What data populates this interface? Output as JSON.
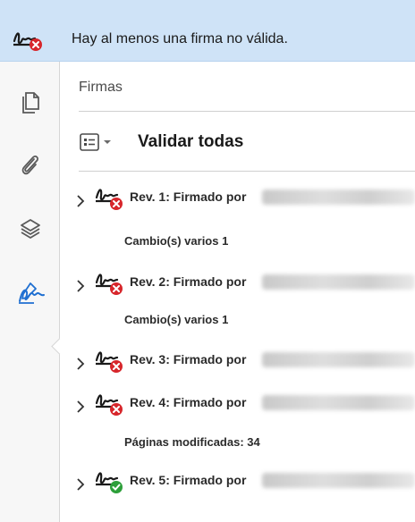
{
  "banner": {
    "message": "Hay al menos una firma no válida."
  },
  "panel": {
    "title": "Firmas",
    "validate_all": "Validar todas"
  },
  "revisions": [
    {
      "label": "Rev. 1: Firmado por",
      "status": "invalid",
      "detail": "Cambio(s) varios 1"
    },
    {
      "label": "Rev. 2: Firmado por",
      "status": "invalid",
      "detail": "Cambio(s) varios 1"
    },
    {
      "label": "Rev. 3: Firmado por",
      "status": "invalid",
      "detail": ""
    },
    {
      "label": "Rev. 4: Firmado por",
      "status": "invalid",
      "detail": "Páginas modificadas: 34"
    },
    {
      "label": "Rev. 5: Firmado por",
      "status": "valid",
      "detail": ""
    }
  ],
  "sidebar": {
    "items": [
      {
        "name": "pages-icon"
      },
      {
        "name": "attachments-icon"
      },
      {
        "name": "layers-icon"
      },
      {
        "name": "signatures-icon",
        "active": true
      }
    ]
  },
  "colors": {
    "banner_bg": "#cfe3f7",
    "invalid": "#d7262b",
    "valid": "#2d9f3a",
    "active_icon": "#1f6fd1"
  }
}
